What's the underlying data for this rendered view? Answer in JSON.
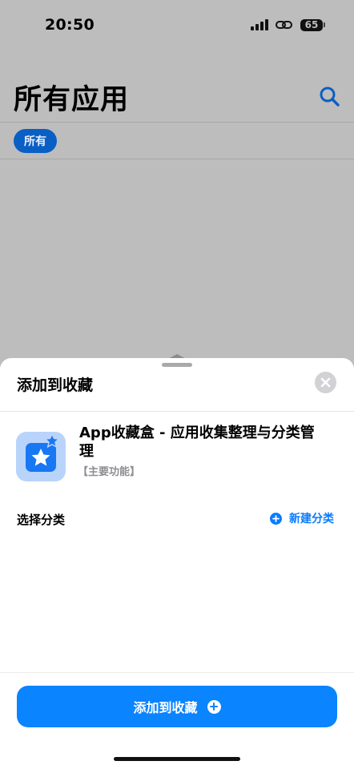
{
  "status_bar": {
    "time": "20:50",
    "battery": "65",
    "icons": [
      "signal-icon",
      "link-icon",
      "battery-icon"
    ]
  },
  "page": {
    "title": "所有应用",
    "filter_chip": "所有",
    "search_icon": "search-icon"
  },
  "sheet": {
    "title": "添加到收藏",
    "close_icon": "close-icon",
    "app": {
      "name": "App收藏盒 - 应用收集整理与分类管理",
      "tag": "【主要功能】",
      "icon": "star-app-icon"
    },
    "category_label": "选择分类",
    "new_category_label": "新建分类",
    "primary_button_label": "添加到收藏"
  },
  "colors": {
    "accent": "#0a84ff",
    "chip": "#0a5fc4",
    "dim_background": "#bdbdbd",
    "app_icon_bg": "#b9d4fb",
    "app_icon_fg": "#1877f2"
  }
}
